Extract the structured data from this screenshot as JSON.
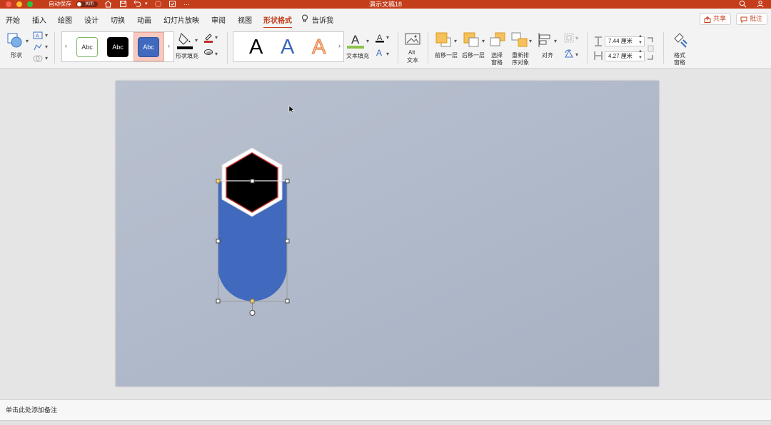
{
  "titlebar": {
    "autosave_label": "自动保存",
    "autosave_state": "关闭",
    "document_title": "演示文稿18",
    "more": "···"
  },
  "tabs": [
    {
      "label": "开始"
    },
    {
      "label": "插入"
    },
    {
      "label": "绘图"
    },
    {
      "label": "设计"
    },
    {
      "label": "切换"
    },
    {
      "label": "动画"
    },
    {
      "label": "幻灯片放映"
    },
    {
      "label": "审阅"
    },
    {
      "label": "视图"
    },
    {
      "label": "形状格式",
      "active": true
    }
  ],
  "tell_me": "告诉我",
  "share_label": "共享",
  "comments_label": "批注",
  "ribbon": {
    "shape_label": "形状",
    "style_samples": [
      "Abc",
      "Abc",
      "Abc"
    ],
    "shape_fill_label": "形状填充",
    "wordart_samples": [
      "A",
      "A",
      "A"
    ],
    "text_fill_label": "文本填充",
    "alt_text_line1": "Alt",
    "alt_text_line2": "文本",
    "bring_forward": "前移一层",
    "send_backward": "后移一层",
    "selection_pane_line1": "选择",
    "selection_pane_line2": "窗格",
    "reorder_line1": "重新排",
    "reorder_line2": "序对象",
    "align": "对齐",
    "height_value": "7.44 厘米",
    "width_value": "4.27 厘米",
    "format_pane_line1": "格式",
    "format_pane_line2": "窗格"
  },
  "colors": {
    "accent": "#c43e1c",
    "shape_fill": "#4169be",
    "hexagon_fill": "#000000",
    "hexagon_outline": "#ffffff",
    "hexagon_inner_line": "#c42b2b"
  },
  "notes_placeholder": "单击此处添加备注"
}
